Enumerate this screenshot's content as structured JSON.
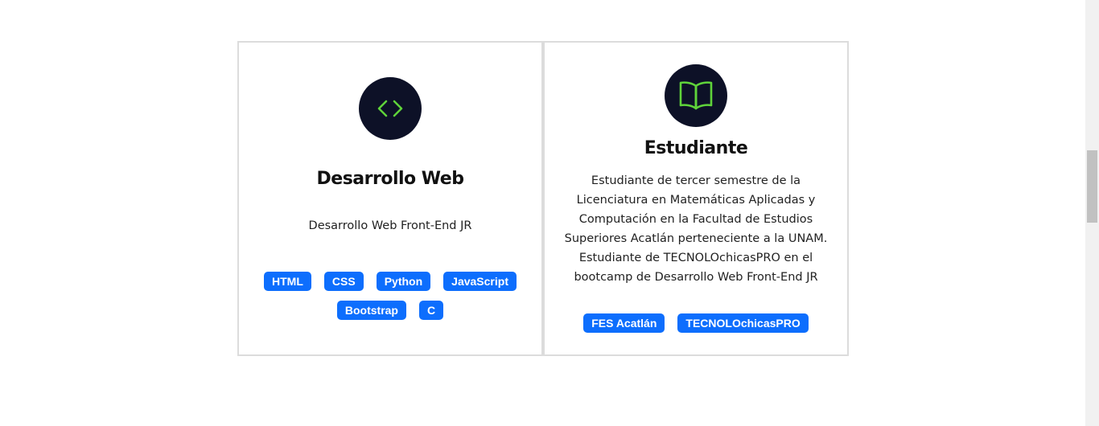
{
  "cards": [
    {
      "icon": "code-icon",
      "title": "Desarrollo Web",
      "text": "Desarrollo Web Front-End JR",
      "tags": [
        "HTML",
        "CSS",
        "Python",
        "JavaScript",
        "Bootstrap",
        "C"
      ]
    },
    {
      "icon": "book-icon",
      "title": "Estudiante",
      "text": "Estudiante de tercer semestre de la Licenciatura en Matemáticas Aplicadas y Computación en la Facultad de Estudios Superiores Acatlán perteneciente a la UNAM. Estudiante de TECNOLOchicasPRO en el bootcamp de Desarrollo Web Front-End JR",
      "tags": [
        "FES Acatlán",
        "TECNOLOchicasPRO"
      ]
    }
  ],
  "colors": {
    "icon_bg": "#0d1127",
    "icon_fg": "#5fd33a",
    "tag_bg": "#0d6efd",
    "tag_fg": "#ffffff",
    "card_border": "#dcdcdc"
  }
}
